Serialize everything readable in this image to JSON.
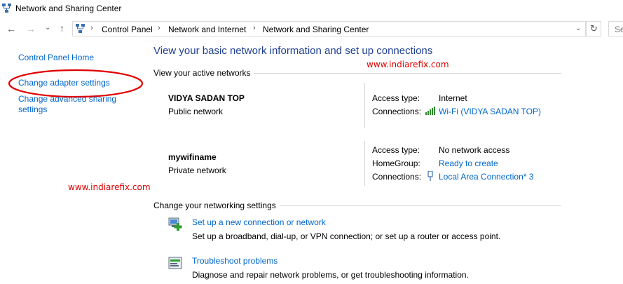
{
  "window": {
    "title": "Network and Sharing Center"
  },
  "address": {
    "crumbs": [
      "Control Panel",
      "Network and Internet",
      "Network and Sharing Center"
    ],
    "search_placeholder": "Se"
  },
  "sidebar": {
    "items": [
      {
        "label": "Control Panel Home"
      },
      {
        "label": "Change adapter settings"
      },
      {
        "label_line1": "Change advanced sharing",
        "label_line2": "settings"
      }
    ]
  },
  "main": {
    "heading": "View your basic network information and set up connections",
    "active_networks_label": "View your active networks",
    "networks": [
      {
        "name": "VIDYA SADAN TOP",
        "type": "Public network",
        "access_type_label": "Access type:",
        "access_type_value": "Internet",
        "connections_label": "Connections:",
        "connections_value": "Wi-Fi (VIDYA SADAN TOP)"
      },
      {
        "name": "mywifiname",
        "type": "Private network",
        "access_type_label": "Access type:",
        "access_type_value": "No network access",
        "homegroup_label": "HomeGroup:",
        "homegroup_value": "Ready to create",
        "connections_label": "Connections:",
        "connections_value": "Local Area Connection* 3"
      }
    ],
    "change_settings_label": "Change your networking settings",
    "tasks": [
      {
        "title": "Set up a new connection or network",
        "description": "Set up a broadband, dial-up, or VPN connection; or set up a router or access point."
      },
      {
        "title": "Troubleshoot problems",
        "description": "Diagnose and repair network problems, or get troubleshooting information."
      }
    ]
  },
  "watermarks": [
    "www.indiarefix.com",
    "www.indiarefix.com"
  ],
  "colors": {
    "link": "#0066cc",
    "heading": "#1e3f8f",
    "watermark": "#e00000",
    "annotation": "#e00000"
  }
}
